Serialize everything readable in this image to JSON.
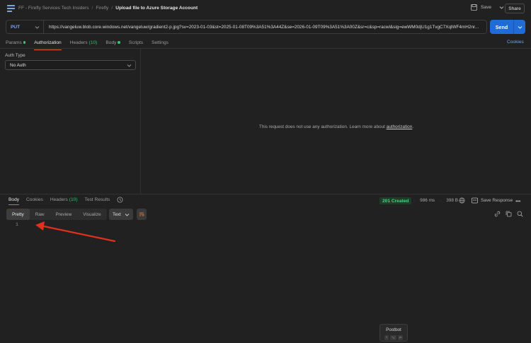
{
  "breadcrumb": {
    "items": [
      "FF - Firefly Services Tech Insiders",
      "Firefly"
    ],
    "current": "Upload file to Azure Storage Account",
    "separator": "/"
  },
  "toolbar": {
    "save_label": "Save",
    "share_label": "Share"
  },
  "request": {
    "method": "PUT",
    "url": "https://vangeluw.blob.core.windows.net/vangeluw/gradient2-p.jpg?sv=2023-01-03&st=2025-01-08T09%3A51%3A44Z&se=2026-01-09T09%3A51%3A00Z&sr=c&sp=racwl&sig=ewWM0djU1g1TvgC7XqlWF4mH2nr...",
    "send_label": "Send"
  },
  "request_tabs": [
    {
      "label": "Params",
      "dot": true,
      "count": ""
    },
    {
      "label": "Authorization",
      "dot": false,
      "count": "",
      "active": true
    },
    {
      "label": "Headers",
      "dot": false,
      "count": "(10)"
    },
    {
      "label": "Body",
      "dot": true,
      "count": ""
    },
    {
      "label": "Scripts",
      "dot": false,
      "count": ""
    },
    {
      "label": "Settings",
      "dot": false,
      "count": ""
    }
  ],
  "cookies_link": "Cookies",
  "auth": {
    "type_label": "Auth Type",
    "selected": "No Auth",
    "message": "This request does not use any authorization. Learn more about ",
    "link_text": "authorization",
    "message_end": "."
  },
  "response_tabs": [
    {
      "label": "Body",
      "count": "",
      "active": true
    },
    {
      "label": "Cookies",
      "count": ""
    },
    {
      "label": "Headers",
      "count": "(10)"
    },
    {
      "label": "Test Results",
      "count": ""
    }
  ],
  "response": {
    "status": "201 Created",
    "time": "986 ms",
    "size": "398 B",
    "save_label": "Save Response",
    "views": [
      "Pretty",
      "Raw",
      "Preview",
      "Visualize"
    ],
    "active_view": "Pretty",
    "format": "Text",
    "line_number": "1"
  },
  "postbot": {
    "title": "Postbot",
    "keys": [
      "^",
      "⌥",
      "P"
    ]
  },
  "colors": {
    "accent": "#e8633a",
    "send": "#1f6bd7",
    "success": "#4fce7f",
    "annotation_arrow": "#e0301e"
  }
}
